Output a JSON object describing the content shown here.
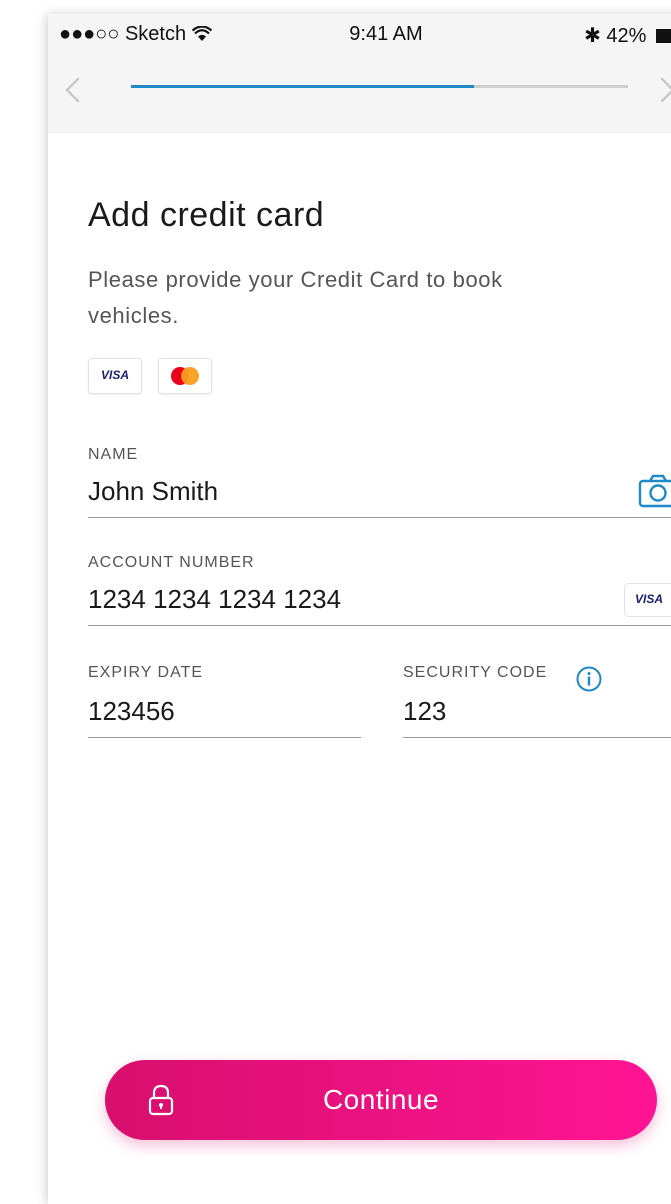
{
  "status_bar": {
    "signal": "●●●○○",
    "carrier": "Sketch",
    "time": "9:41 AM",
    "bluetooth": "✱",
    "battery": "42%"
  },
  "nav": {
    "back_icon": "chevron-left-icon",
    "forward_icon": "chevron-right-icon",
    "progress_fraction": 0.69
  },
  "page": {
    "title": "Add credit card",
    "subtitle": "Please provide your Credit Card to book vehicles.",
    "accepted_cards": [
      "VISA",
      "Mastercard"
    ]
  },
  "form": {
    "name": {
      "label": "NAME",
      "value": "John Smith"
    },
    "account_number": {
      "label": "ACCOUNT NUMBER",
      "value": "1234 1234 1234 1234",
      "card_brand": "VISA"
    },
    "expiry_date": {
      "label": "EXPIRY DATE",
      "value": "123456"
    },
    "security_code": {
      "label": "SECURITY CODE",
      "value": "123"
    }
  },
  "actions": {
    "continue_label": "Continue"
  },
  "colors": {
    "accent_blue": "#1e88c8",
    "button_start": "#d70f6d",
    "button_end": "#ff1493",
    "visa_blue": "#1a1f71",
    "mc_red": "#eb001b",
    "mc_yellow": "#f79e1b"
  }
}
